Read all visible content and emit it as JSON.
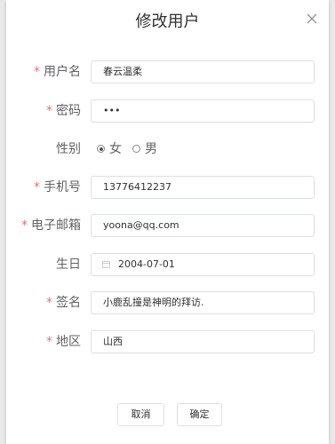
{
  "dialog": {
    "title": "修改用户",
    "close_icon": "close-icon"
  },
  "form": {
    "username": {
      "label": "用户名",
      "required": true,
      "value": "春云温柔"
    },
    "password": {
      "label": "密码",
      "required": true,
      "value": "•••"
    },
    "gender": {
      "label": "性别",
      "required": false,
      "options": [
        "女",
        "男"
      ],
      "selected": "女"
    },
    "phone": {
      "label": "手机号",
      "required": true,
      "value": "13776412237"
    },
    "email": {
      "label": "电子邮箱",
      "required": true,
      "value": "yoona@qq.com"
    },
    "birthday": {
      "label": "生日",
      "required": false,
      "value": "2004-07-01",
      "icon": "calendar-icon"
    },
    "signature": {
      "label": "签名",
      "required": true,
      "value": "小鹿乱撞是神明的拜访."
    },
    "region": {
      "label": "地区",
      "required": true,
      "value": "山西"
    }
  },
  "footer": {
    "cancel_label": "取消",
    "confirm_label": "确定"
  },
  "colors": {
    "required_star": "#f56c6c",
    "border": "#dcdfe6",
    "label_text": "#606266"
  }
}
